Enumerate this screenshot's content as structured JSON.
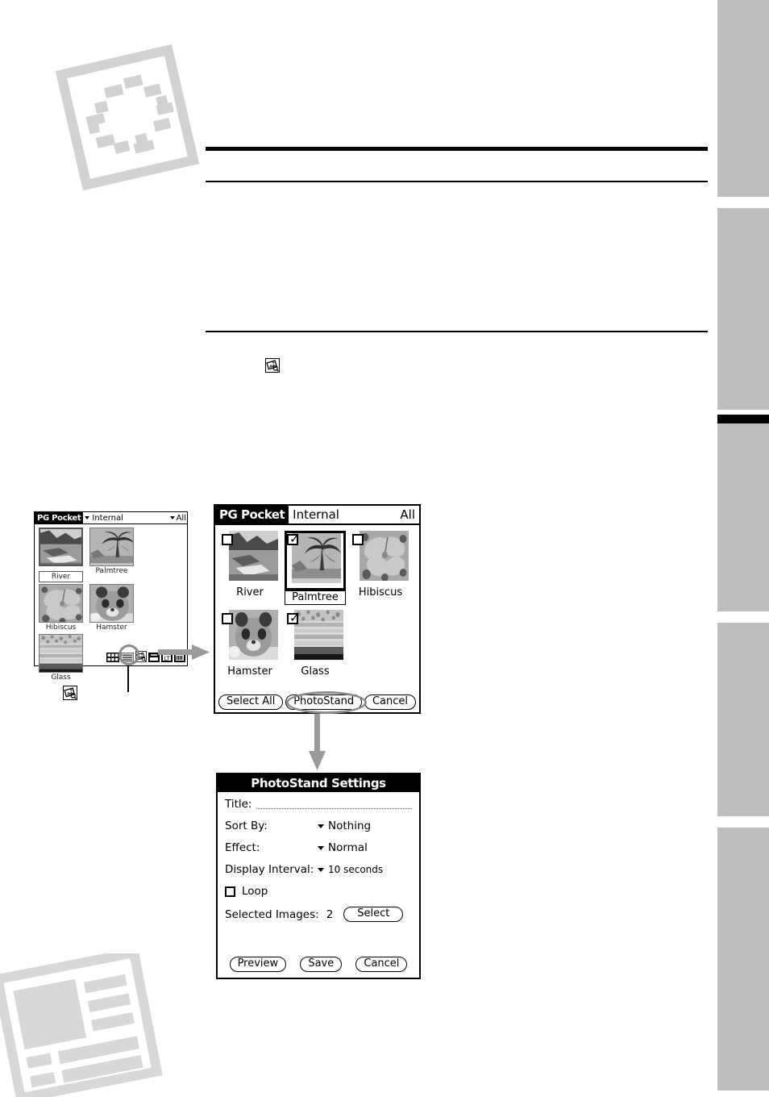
{
  "page": {
    "background": "#ffffff",
    "rule_color": "#000000",
    "watermark_color": "#d2d2d2",
    "tab_color": "#bdbdbd",
    "highlight_color": "#8c8c8c"
  },
  "side_tabs": [
    {
      "name": "tab-1",
      "active": false
    },
    {
      "name": "tab-2",
      "active": false
    },
    {
      "name": "tab-3",
      "active": true
    },
    {
      "name": "tab-4",
      "active": false
    },
    {
      "name": "tab-5",
      "active": false
    }
  ],
  "watermarks": [
    {
      "name": "photo-frame-watermark",
      "color": "#d2d2d2"
    },
    {
      "name": "article-layout-watermark",
      "color": "#d8d8d8"
    }
  ],
  "body_rules": [
    {
      "name": "heading-rule-thick",
      "thickness": 5
    },
    {
      "name": "heading-rule-thin",
      "thickness": 2
    },
    {
      "name": "section-rule-thin",
      "thickness": 2
    }
  ],
  "inline_icons": [
    {
      "name": "photostand-icon-inline-body",
      "glyph": "photostand"
    },
    {
      "name": "photostand-icon-inline-callout",
      "glyph": "photostand"
    }
  ],
  "pg_pocket_small": {
    "window_name": "PG Pocket",
    "title": "PG Pocket",
    "category": "Internal",
    "scope": "All",
    "items": [
      {
        "caption": "River",
        "selected": true,
        "checked": false,
        "image": "river"
      },
      {
        "caption": "Palmtree",
        "selected": false,
        "checked": false,
        "image": "palmtree"
      },
      {
        "caption": "Hibiscus",
        "selected": false,
        "checked": false,
        "image": "hibiscus"
      },
      {
        "caption": "Hamster",
        "selected": false,
        "checked": false,
        "image": "hamster"
      },
      {
        "caption": "Glass",
        "selected": false,
        "checked": false,
        "image": "glass"
      }
    ],
    "toolbar": [
      {
        "name": "thumbnail-view-icon",
        "glyph": "grid"
      },
      {
        "name": "list-view-icon",
        "glyph": "list"
      },
      {
        "name": "photostand-icon",
        "glyph": "photostand",
        "highlighted": true
      },
      {
        "name": "beam-icon",
        "glyph": "beam"
      },
      {
        "name": "details-icon",
        "glyph": "details"
      },
      {
        "name": "info-icon",
        "glyph": "info"
      }
    ]
  },
  "pg_pocket_large": {
    "window_name": "PG Pocket",
    "title": "PG Pocket",
    "category": "Internal",
    "scope": "All",
    "items": [
      {
        "caption": "River",
        "checked": false,
        "selected": false,
        "image": "river"
      },
      {
        "caption": "Palmtree",
        "checked": true,
        "selected": true,
        "image": "palmtree"
      },
      {
        "caption": "Hibiscus",
        "checked": false,
        "selected": false,
        "image": "hibiscus"
      },
      {
        "caption": "Hamster",
        "checked": false,
        "selected": false,
        "image": "hamster"
      },
      {
        "caption": "Glass",
        "checked": true,
        "selected": false,
        "image": "glass"
      }
    ],
    "checkmark_glyph": "☑",
    "buttons": {
      "select_all": "Select All",
      "photostand": "PhotoStand",
      "cancel": "Cancel"
    },
    "photostand_highlighted": true
  },
  "photostand_settings": {
    "title": "PhotoStand Settings",
    "fields": {
      "title_label": "Title:",
      "title_value": "",
      "title_placeholder": "",
      "sort_by_label": "Sort By:",
      "sort_by_value": "Nothing",
      "effect_label": "Effect:",
      "effect_value": "Normal",
      "display_interval_label": "Display Interval:",
      "display_interval_value": "10 seconds",
      "loop_label": "Loop",
      "loop_checked": false,
      "selected_images_label": "Selected Images:",
      "selected_images_value": "2",
      "select_button": "Select"
    },
    "buttons": {
      "preview": "Preview",
      "save": "Save",
      "cancel": "Cancel"
    }
  },
  "connectors": [
    {
      "name": "arrow-small-to-large",
      "direction": "right",
      "color": "#9a9a9a"
    },
    {
      "name": "arrow-large-to-settings",
      "direction": "down",
      "color": "#9a9a9a"
    }
  ]
}
